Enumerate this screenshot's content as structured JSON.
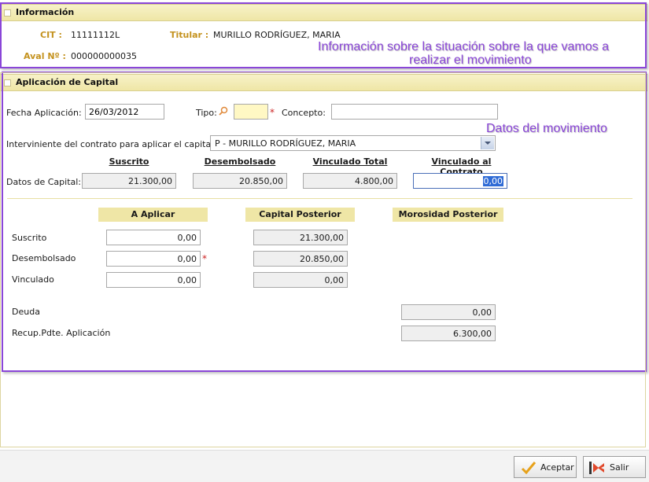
{
  "info_section": {
    "title": "Información",
    "cit_label": "CIT :",
    "cit_value": "11111112L",
    "titular_label": "Titular :",
    "titular_value": "MURILLO RODRÍGUEZ, MARIA",
    "aval_label": "Aval Nº :",
    "aval_value": "000000000035"
  },
  "annotations": {
    "info_line1": "Información sobre la situación sobre la que vamos a",
    "info_line2": "realizar el movimiento",
    "movement": "Datos del movimiento"
  },
  "capital_section": {
    "title": "Aplicación de Capital",
    "fecha_label": "Fecha Aplicación:",
    "fecha_value": "26/03/2012",
    "tipo_label": "Tipo:",
    "tipo_value": "",
    "concepto_label": "Concepto:",
    "concepto_value": "",
    "interviniente_label": "Interviniente del contrato para aplicar el capital:",
    "interviniente_value": "P - MURILLO RODRÍGUEZ, MARIA",
    "datos_label": "Datos de Capital:",
    "columns": {
      "suscrito": "Suscrito",
      "desembolsado": "Desembolsado",
      "vinculado_total": "Vinculado Total",
      "vinculado_contrato": "Vinculado al Contrato"
    },
    "datos_values": {
      "suscrito": "21.300,00",
      "desembolsado": "20.850,00",
      "vinculado_total": "4.800,00",
      "vinculado_contrato": "0,00"
    }
  },
  "aplicar": {
    "headers": {
      "a_aplicar": "A Aplicar",
      "capital_posterior": "Capital Posterior",
      "morosidad_posterior": "Morosidad Posterior"
    },
    "rows": [
      {
        "label": "Suscrito",
        "a_aplicar": "0,00",
        "capital_posterior": "21.300,00"
      },
      {
        "label": "Desembolsado",
        "a_aplicar": "0,00",
        "capital_posterior": "20.850,00"
      },
      {
        "label": "Vinculado",
        "a_aplicar": "0,00",
        "capital_posterior": "0,00"
      }
    ],
    "deuda_label": "Deuda",
    "deuda_value": "0,00",
    "recup_label": "Recup.Pdte. Aplicación",
    "recup_value": "6.300,00"
  },
  "buttons": {
    "aceptar": "Aceptar",
    "salir": "Salir"
  },
  "colors": {
    "accent_purple": "#8a46d8",
    "gold_label": "#c4921e",
    "header_yellow": "#efe6a6",
    "required_red": "#cc2222"
  }
}
